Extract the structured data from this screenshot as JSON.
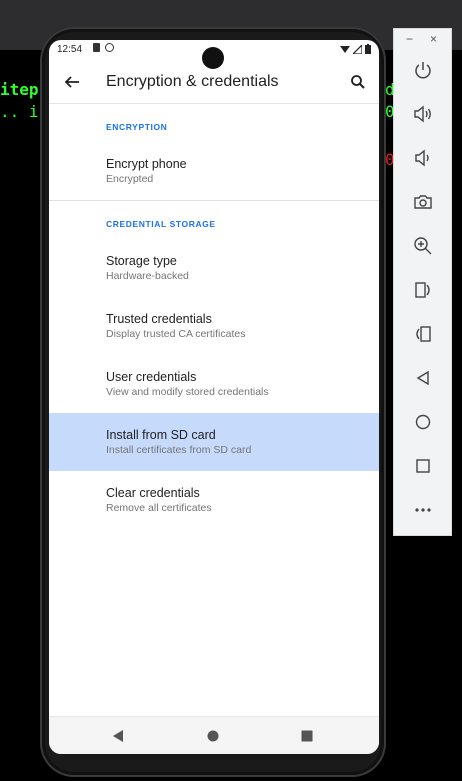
{
  "terminal": {
    "line1_left": "itep",
    "line1_right": "d",
    "line2_left": ".. ip",
    "line2_right": "0",
    "line2_far": ")",
    "line3_right": "0"
  },
  "status_bar": {
    "time": "12:54"
  },
  "app_bar": {
    "title": "Encryption & credentials",
    "back_icon": "arrow-left-icon",
    "search_icon": "search-icon"
  },
  "sections": [
    {
      "header": "ENCRYPTION",
      "items": [
        {
          "title": "Encrypt phone",
          "summary": "Encrypted"
        }
      ]
    },
    {
      "header": "CREDENTIAL STORAGE",
      "items": [
        {
          "title": "Storage type",
          "summary": "Hardware-backed"
        },
        {
          "title": "Trusted credentials",
          "summary": "Display trusted CA certificates"
        },
        {
          "title": "User credentials",
          "summary": "View and modify stored credentials"
        },
        {
          "title": "Install from SD card",
          "summary": "Install certificates from SD card",
          "selected": true
        },
        {
          "title": "Clear credentials",
          "summary": "Remove all certificates"
        }
      ]
    }
  ],
  "nav_bar": {
    "buttons": [
      "back-triangle-icon",
      "home-circle-icon",
      "recents-square-icon"
    ]
  },
  "emulator_toolbar": {
    "minimize": "−",
    "close": "×",
    "tools": [
      "power-icon",
      "volume-up-icon",
      "volume-down-icon",
      "camera-icon",
      "zoom-in-icon",
      "rotate-left-icon",
      "rotate-right-icon",
      "back-icon",
      "home-icon",
      "overview-icon",
      "more-icon"
    ]
  },
  "colors": {
    "accent": "#1a73e8",
    "selected_row": "#c6dafc",
    "terminal_green": "#2cff2c",
    "terminal_red": "#e31b1b"
  }
}
